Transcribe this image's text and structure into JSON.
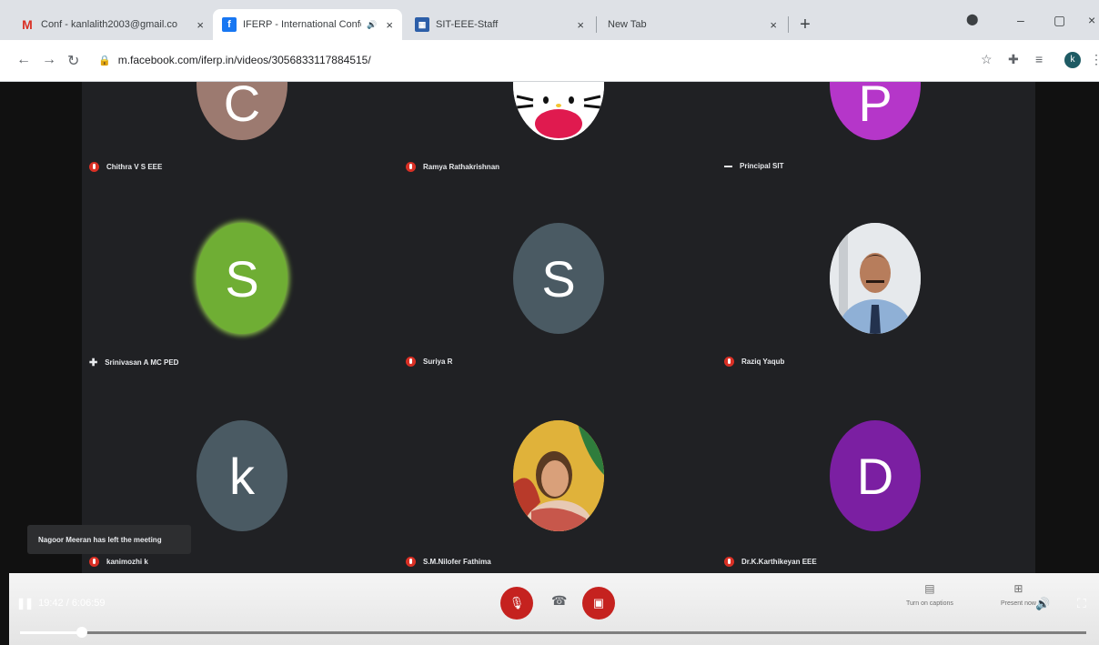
{
  "browser": {
    "tabs": [
      {
        "title": "Conf - kanlalith2003@gmail.co",
        "icon": "gmail-icon",
        "active": false
      },
      {
        "title": "IFERP - International Confer",
        "icon": "facebook-icon",
        "active": true
      },
      {
        "title": "SIT-EEE-Staff",
        "icon": "sheets-icon",
        "active": false
      },
      {
        "title": "New Tab",
        "icon": "",
        "active": false
      }
    ],
    "tab_close": "×",
    "new_tab": "+",
    "window_controls": {
      "minimize": "–",
      "maximize": "▢",
      "close": "×"
    },
    "url": "m.facebook.com/iferp.in/videos/3056833117884515/",
    "profile_initial": "k"
  },
  "meeting": {
    "participants": [
      {
        "initial": "C",
        "color": "#9c7a70",
        "name": "Chithra V S EEE",
        "status": "muted"
      },
      {
        "initial": "",
        "color": "#ffffff",
        "name": "Ramya Rathakrishnan",
        "status": "muted",
        "photo": "hello-kitty"
      },
      {
        "initial": "P",
        "color": "#b536c9",
        "name": "Principal SIT",
        "status": "speaking"
      },
      {
        "initial": "S",
        "color": "#6fae34",
        "name": "Srinivasan A MC PED",
        "status": "active"
      },
      {
        "initial": "S",
        "color": "#4a5a63",
        "name": "Suriya R",
        "status": "muted"
      },
      {
        "initial": "",
        "color": "#d8dde2",
        "name": "Raziq Yaqub",
        "status": "muted",
        "photo": "man-portrait"
      },
      {
        "initial": "k",
        "color": "#4a5a63",
        "name": "kanimozhi k",
        "status": "muted"
      },
      {
        "initial": "",
        "color": "#d9a53a",
        "name": "S.M.Nilofer Fathima",
        "status": "muted",
        "photo": "woman-portrait"
      },
      {
        "initial": "D",
        "color": "#7b1fa2",
        "name": "Dr.K.Karthikeyan EEE",
        "status": "muted"
      }
    ],
    "toast": "Nagoor Meeran has left the meeting",
    "controls": {
      "captions_label": "Turn on captions",
      "present_label": "Present now"
    }
  },
  "player": {
    "current_time": "19:42",
    "separator": " / ",
    "duration": "6:06:59",
    "progress_fraction": 0.058
  },
  "colors": {
    "accent_red": "#c5221f",
    "stage": "#202124"
  }
}
